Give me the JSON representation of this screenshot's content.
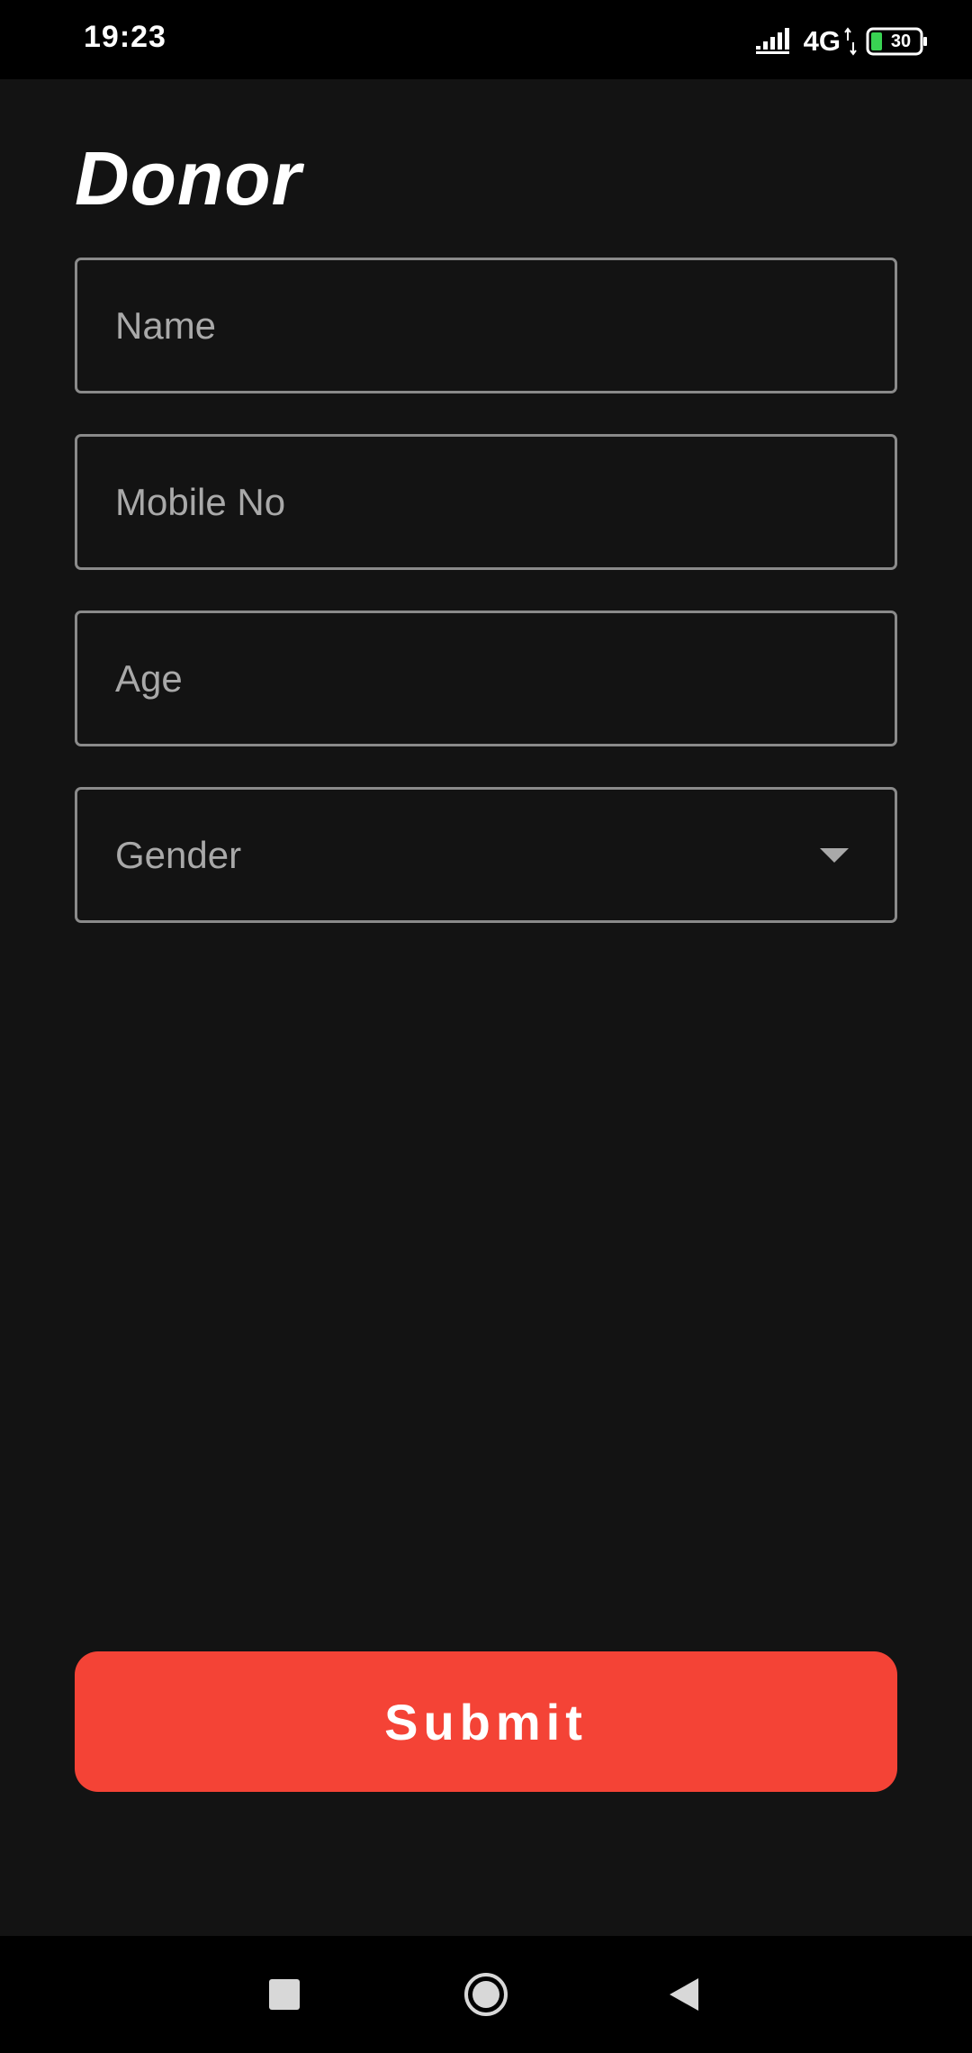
{
  "status_bar": {
    "time": "19:23",
    "network": "4G",
    "battery": "30",
    "icons": [
      "signal-icon",
      "data-arrows-icon",
      "battery-icon"
    ]
  },
  "page": {
    "title": "Donor"
  },
  "form": {
    "name_placeholder": "Name",
    "mobile_placeholder": "Mobile No",
    "age_placeholder": "Age",
    "gender_placeholder": "Gender",
    "submit_label": "Submit"
  },
  "nav_bar": {
    "icons": [
      "recents-square-icon",
      "home-circle-icon",
      "back-triangle-icon"
    ]
  },
  "colors": {
    "background": "#131313",
    "accent": "#f44336",
    "field_border": "#8a8a8a",
    "placeholder": "#a9a9a9"
  }
}
